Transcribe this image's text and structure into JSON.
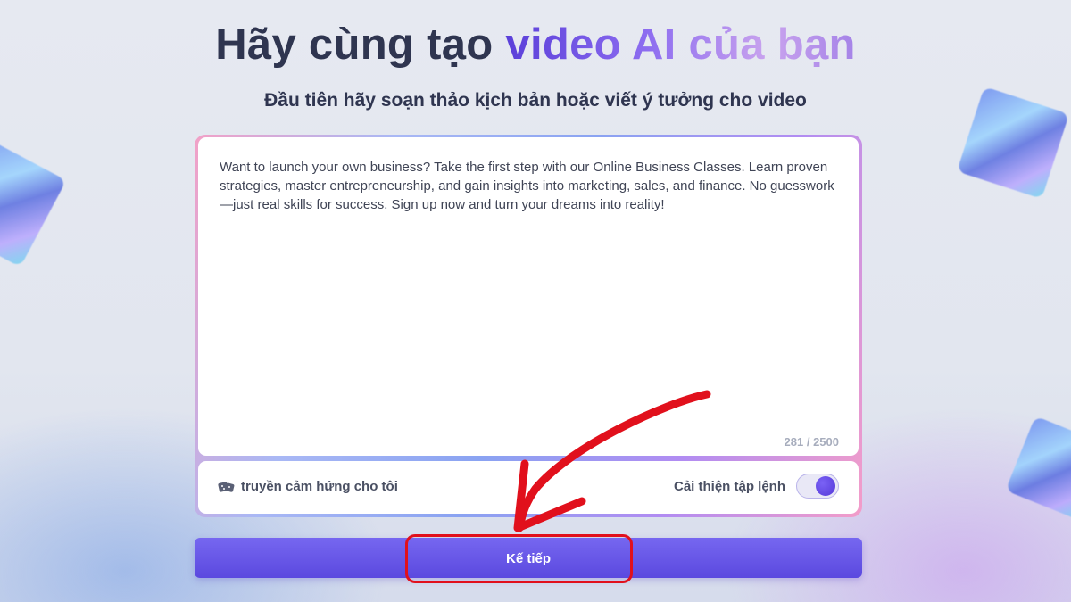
{
  "header": {
    "title_plain": "Hãy cùng tạo",
    "title_highlight": "video AI của bạn",
    "subtitle": "Đầu tiên hãy soạn thảo kịch bản hoặc viết ý tưởng cho video"
  },
  "editor": {
    "text": "Want to launch your own business? Take the first step with our Online Business Classes. Learn proven strategies, master entrepreneurship, and gain insights into marketing, sales, and finance. No guesswork—just real skills for success. Sign up now and turn your dreams into reality!",
    "counter": "281 / 2500"
  },
  "options": {
    "inspire_label": "truyền cảm hứng cho tôi",
    "inspire_icon": "dice-icon",
    "improve_label": "Cải thiện tập lệnh",
    "improve_enabled": true
  },
  "actions": {
    "next_label": "Kế tiếp"
  },
  "annotation": {
    "color": "#e1101c"
  }
}
